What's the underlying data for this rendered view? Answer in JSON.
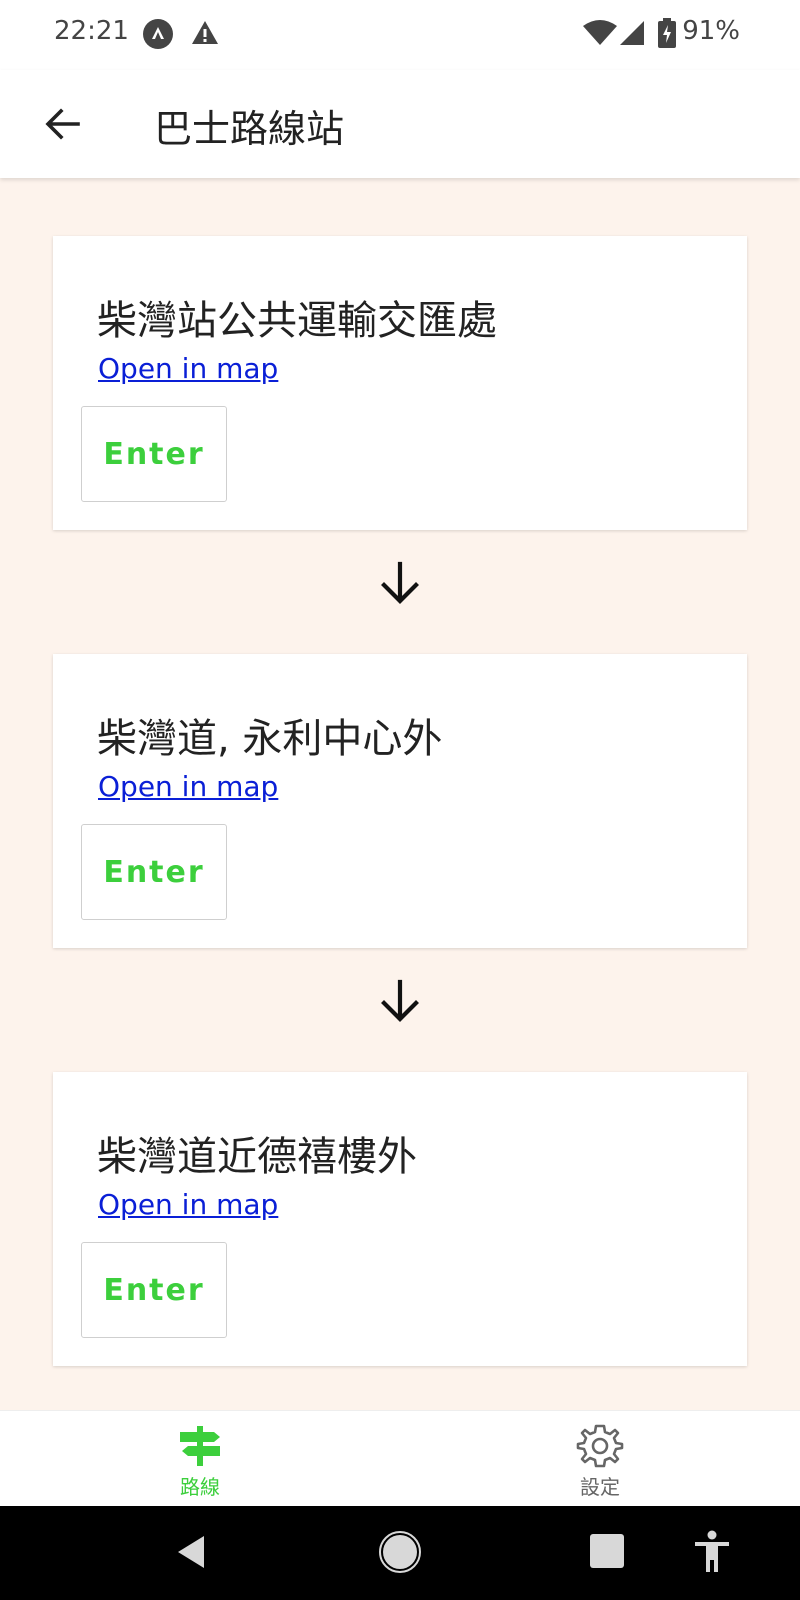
{
  "status_bar": {
    "time": "22:21",
    "battery": "91%",
    "icons": [
      "notification-a-icon",
      "warning-icon",
      "wifi-icon",
      "signal-icon",
      "battery-charging-icon"
    ]
  },
  "app_bar": {
    "title": "巴士路線站",
    "back_icon": "arrow-left-icon"
  },
  "stops": [
    {
      "name": "柴灣站公共運輸交匯處",
      "link": "Open in map",
      "enter": "Enter"
    },
    {
      "name": "柴灣道, 永利中心外",
      "link": "Open in map",
      "enter": "Enter"
    },
    {
      "name": "柴灣道近德禧樓外",
      "link": "Open in map",
      "enter": "Enter"
    }
  ],
  "bottom_nav": {
    "items": [
      {
        "label": "路線",
        "icon": "signpost-icon",
        "active": true
      },
      {
        "label": "設定",
        "icon": "gear-icon",
        "active": false
      }
    ]
  },
  "colors": {
    "background": "#fdf3ec",
    "link": "#0a1fd6",
    "accent_green": "#3ccf3c",
    "inactive_gray": "#666666"
  }
}
